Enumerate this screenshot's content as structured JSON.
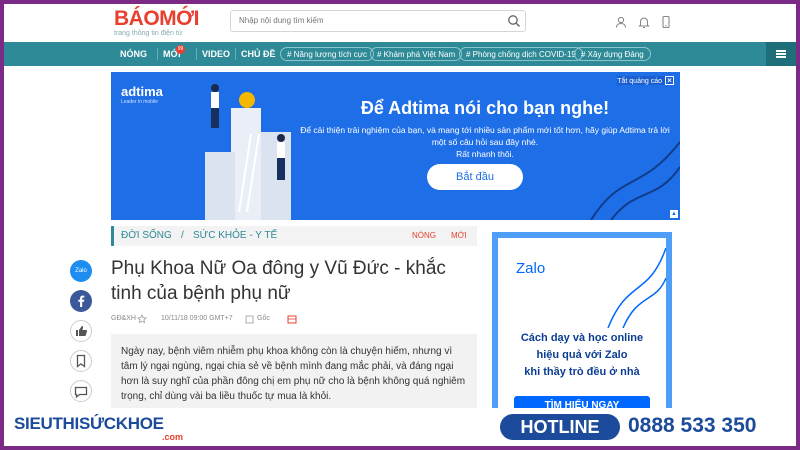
{
  "header": {
    "logo": "BÁOMỚI",
    "logo_tagline": "trang thông tin điện tử",
    "search_placeholder": "Nhập nội dung tìm kiếm"
  },
  "nav": {
    "items": [
      "NÓNG",
      "MỚI",
      "VIDEO",
      "CHỦ ĐỀ"
    ],
    "new_badge": "99",
    "tags": [
      "# Năng lượng tích cực",
      "# Khám phá Việt Nam",
      "# Phòng chống dịch COVID-19",
      "# Xây dựng Đảng"
    ]
  },
  "ad": {
    "close_label": "Tắt quảng cáo",
    "brand": "adtima",
    "brand_sub": "Leader in mobile",
    "title": "Để Adtima nói cho bạn nghe!",
    "body": "Để cải thiện trải nghiệm của bạn, và mang tới nhiều sản phẩm mới tốt hơn, hãy giúp Adtima trả lời một số câu hỏi sau đây nhé.",
    "body2": "Rất nhanh thôi.",
    "cta": "Bắt đầu",
    "color": "#1e6ee8"
  },
  "breadcrumb": {
    "items": [
      "ĐỜI SỐNG",
      "/",
      "SỨC KHỎE - Y TẾ"
    ],
    "right": [
      "NÓNG",
      "MỚI"
    ]
  },
  "article": {
    "title": "Phụ Khoa Nữ Oa đông y Vũ Đức - khắc tinh của bệnh phụ nữ",
    "source": "GĐ&XH",
    "date": "10/11/18 09:00 GMT+7",
    "origin": "Gốc",
    "sapo": "Ngày nay, bệnh viêm nhiễm phụ khoa không còn là chuyện hiếm, nhưng vì tâm lý ngại ngùng, ngại chia sẻ về bệnh mình đang mắc phải, và đáng ngại hơn là suy nghĩ của phần đông chị em phụ nữ cho là bệnh không quá nghiêm trọng, chỉ dùng vài ba liều thuốc tự mua là khỏi."
  },
  "social": {
    "zalo": "Zalo"
  },
  "zalo_ad": {
    "logo": "Zalo",
    "line1": "Cách dạy và học online",
    "line2": "hiệu quả với Zalo",
    "line3": "khi thầy trò đều ở nhà",
    "cta": "TÌM HIỂU NGAY"
  },
  "footer": {
    "brand": "SIEUTHISỨCKHOE",
    "brand_domain": ".com",
    "hotline_label": "HOTLINE",
    "phone": "0888 533 350"
  }
}
